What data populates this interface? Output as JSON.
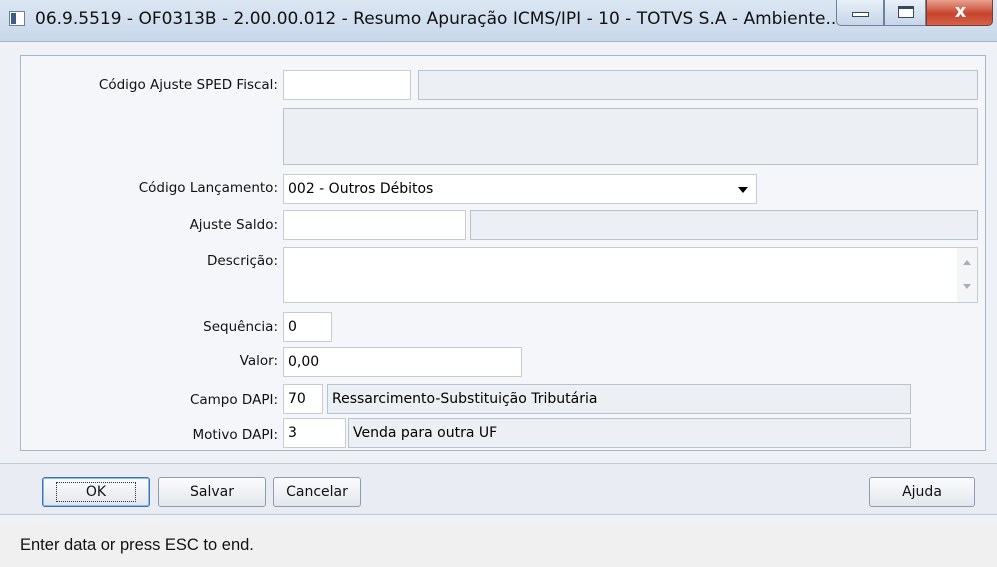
{
  "window": {
    "title": "06.9.5519 - OF0313B - 2.00.00.012 - Resumo Apuração ICMS/IPI - 10 - TOTVS S.A - Ambiente...",
    "icon": "app-window-icon",
    "close_glyph": "x"
  },
  "form": {
    "codigo_ajuste_sped": {
      "label": "Código Ajuste SPED Fiscal:",
      "value": "",
      "description": "",
      "long_description": ""
    },
    "codigo_lancamento": {
      "label": "Código Lançamento:",
      "selected": "002 - Outros Débitos"
    },
    "ajuste_saldo": {
      "label": "Ajuste Saldo:",
      "value": "",
      "description": ""
    },
    "descricao": {
      "label": "Descrição:",
      "value": ""
    },
    "sequencia": {
      "label": "Sequência:",
      "value": "0"
    },
    "valor": {
      "label": "Valor:",
      "value": "0,00"
    },
    "campo_dapi": {
      "label": "Campo DAPI:",
      "code": "70",
      "description": "Ressarcimento-Substituição Tributária"
    },
    "motivo_dapi": {
      "label": "Motivo DAPI:",
      "code": "3",
      "description": "Venda para outra UF"
    }
  },
  "buttons": {
    "ok": "OK",
    "salvar": "Salvar",
    "cancelar": "Cancelar",
    "ajuda": "Ajuda"
  },
  "status": {
    "text": "Enter data or press ESC to end."
  }
}
